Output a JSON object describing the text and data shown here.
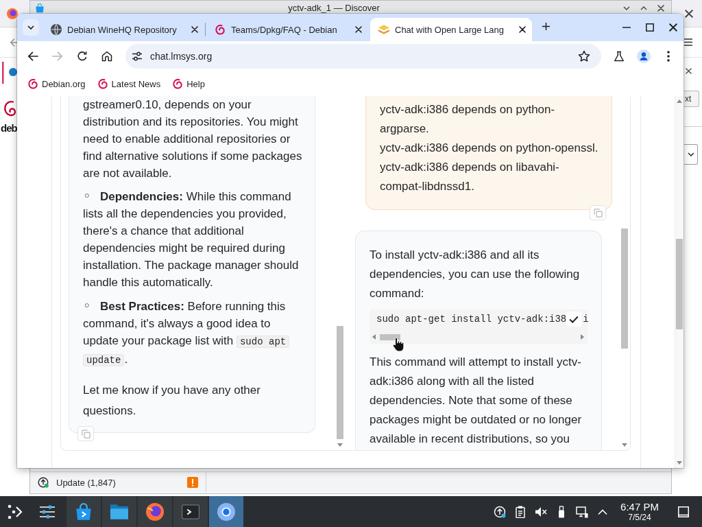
{
  "back_windows": {
    "firefox": {
      "page_text": "deb",
      "button_text": "xt"
    },
    "discover": {
      "title": "yctv-adk_1 — Discover",
      "status": {
        "label": "Update (1,847)",
        "warning": true
      }
    }
  },
  "browser": {
    "tabs": [
      {
        "title": "Debian WineHQ Repository",
        "kind": "globe",
        "selected": false
      },
      {
        "title": "Teams/Dpkg/FAQ - Debian",
        "kind": "debian",
        "selected": false
      },
      {
        "title": "Chat with Open Large Lang",
        "kind": "lmsys",
        "selected": true
      }
    ],
    "forward_disabled": true,
    "url": "chat.lmsys.org",
    "bookmarks": [
      {
        "label": "Debian.org"
      },
      {
        "label": "Latest News"
      },
      {
        "label": "Help"
      }
    ]
  },
  "chat": {
    "left_message": {
      "blocks": [
        {
          "kind": "paragraph",
          "text": "gstreamer0.10, depends on your distribution and its repositories. You might need to enable additional repositories or find alternative solutions if some packages are not available."
        },
        {
          "kind": "bullet",
          "marker": "◦",
          "text": "**Dependencies:** While this command lists all the dependencies you provided, there's a chance that additional dependencies might be required during installation. The package manager should handle this automatically."
        },
        {
          "kind": "bullet",
          "marker": "◦",
          "text": "**Best Practices:** Before running this command, it's always a good idea to update your package list with ",
          "code": "sudo apt update",
          "text_after": "."
        },
        {
          "kind": "closing",
          "text": "Let me know if you have any other questions."
        }
      ]
    },
    "user_message": {
      "lines": [
        "yctv-adk:i386 depends on python-argparse.",
        "yctv-adk:i386 depends on python-openssl.",
        "yctv-adk:i386 depends on libavahi-compat-libdnssd1."
      ]
    },
    "bot_message": {
      "intro": "To install yctv-adk:i386 and all its dependencies, you can use the following command:",
      "code": {
        "text": "sudo apt-get install yctv-adk:i38",
        "text_after_button": "i",
        "copied": true
      },
      "outro": "This command will attempt to install yctv-adk:i386 along with all the listed dependencies. Note that some of these packages might be outdated or no longer available in recent distributions, so you"
    }
  },
  "taskbar": {
    "apps": [
      {
        "kind": "discover",
        "selected": false
      },
      {
        "kind": "files",
        "selected": false
      },
      {
        "kind": "firefox",
        "selected": false
      },
      {
        "kind": "terminal",
        "selected": false
      },
      {
        "kind": "chromium",
        "selected": true
      }
    ],
    "volume_muted": true,
    "time": "6:47 PM",
    "date": "7/5/24"
  }
}
